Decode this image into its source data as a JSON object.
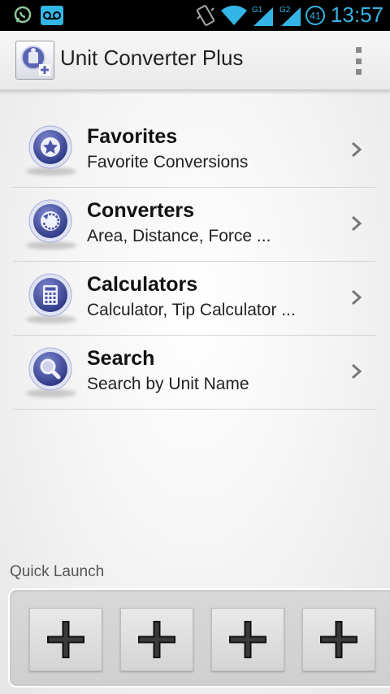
{
  "status_bar": {
    "time": "13:57",
    "battery_level": "41",
    "sim1_label": "G1",
    "sim2_label": "G2",
    "icons": [
      "whatsapp-icon",
      "voicemail-icon",
      "vibrate-icon",
      "wifi-icon",
      "signal-sim1-icon",
      "signal-sim2-icon",
      "battery-icon"
    ]
  },
  "action_bar": {
    "title": "Unit Converter Plus",
    "overflow_icon": "overflow-menu-icon"
  },
  "menu": [
    {
      "title": "Favorites",
      "subtitle": "Favorite Conversions",
      "icon": "star-icon"
    },
    {
      "title": "Converters",
      "subtitle": "Area, Distance, Force ...",
      "icon": "converter-cycle-icon"
    },
    {
      "title": "Calculators",
      "subtitle": "Calculator, Tip Calculator ...",
      "icon": "calculator-icon"
    },
    {
      "title": "Search",
      "subtitle": "Search by Unit Name",
      "icon": "search-icon"
    }
  ],
  "quick_launch": {
    "label": "Quick Launch",
    "slots": [
      "add-icon",
      "add-icon",
      "add-icon",
      "add-icon"
    ]
  },
  "colors": {
    "status_accent": "#33b5e5",
    "orb_blue": "#4a55a8"
  }
}
